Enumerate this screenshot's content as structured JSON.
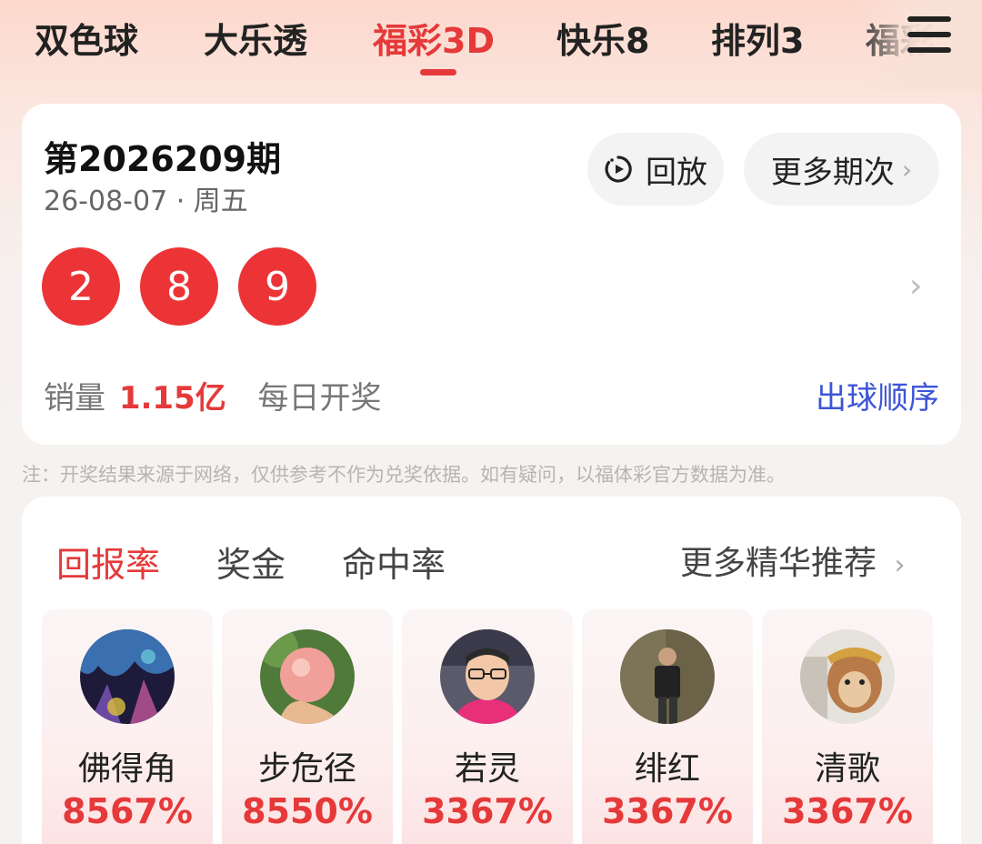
{
  "tabs": [
    {
      "label": "双色球"
    },
    {
      "label": "大乐透"
    },
    {
      "label": "福彩3D",
      "active": true
    },
    {
      "label": "快乐8"
    },
    {
      "label": "排列3"
    },
    {
      "label": "福彩"
    }
  ],
  "draw": {
    "issue": "第2026209期",
    "date": "26-08-07 · 周五",
    "replay_label": "回放",
    "more_issues_label": "更多期次",
    "balls": [
      "2",
      "8",
      "9"
    ],
    "sales_label": "销量",
    "sales_amount": "1.15亿",
    "frequency": "每日开奖",
    "ball_order_label": "出球顺序"
  },
  "note": "注：开奖结果来源于网络，仅供参考不作为兑奖依据。如有疑问，以福体彩官方数据为准。",
  "recommend": {
    "tabs": [
      {
        "label": "回报率",
        "active": true
      },
      {
        "label": "奖金"
      },
      {
        "label": "命中率"
      }
    ],
    "more_label": "更多精华推荐",
    "experts": [
      {
        "name": "佛得角",
        "rate": "8567%"
      },
      {
        "name": "步危径",
        "rate": "8550%"
      },
      {
        "name": "若灵",
        "rate": "3367%"
      },
      {
        "name": "绯红",
        "rate": "3367%"
      },
      {
        "name": "清歌",
        "rate": "3367%"
      }
    ]
  },
  "colors": {
    "accent": "#e5393a",
    "link": "#3d55d5",
    "ball": "#ec3437"
  },
  "icons": [
    "menu-icon",
    "replay-icon",
    "chevron-right-icon"
  ]
}
